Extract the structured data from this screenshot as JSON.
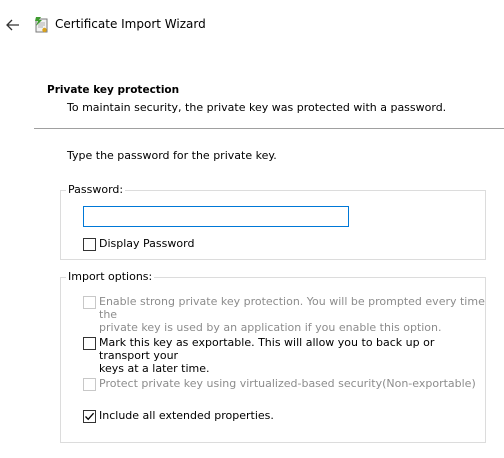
{
  "window": {
    "title": "Certificate Import Wizard",
    "back_icon": "arrow-left-icon",
    "app_icon": "certificate-wizard-icon"
  },
  "header": {
    "heading": "Private key protection",
    "description": "To maintain security, the private key was protected with a password."
  },
  "main": {
    "instruction": "Type the password for the private key.",
    "password_group": {
      "legend": "Password:",
      "input_value": "",
      "display_password_label": "Display Password",
      "display_password_checked": false
    },
    "import_options": {
      "legend": "Import options:",
      "options": [
        {
          "label_line1": "Enable strong private key protection. You will be prompted every time the",
          "label_line2": "private key is used by an application if you enable this option.",
          "checked": false,
          "enabled": false
        },
        {
          "label_line1": "Mark this key as exportable. This will allow you to back up or transport your",
          "label_line2": "keys at a later time.",
          "checked": false,
          "enabled": true
        },
        {
          "label_line1": "Protect private key using virtualized-based security(Non-exportable)",
          "checked": false,
          "enabled": false
        },
        {
          "label_line1": "Include all extended properties.",
          "checked": true,
          "enabled": true
        }
      ]
    }
  },
  "colors": {
    "input_focus_border": "#0078d7",
    "disabled_text": "#8c8c8c",
    "divider": "#a0a0a0"
  }
}
